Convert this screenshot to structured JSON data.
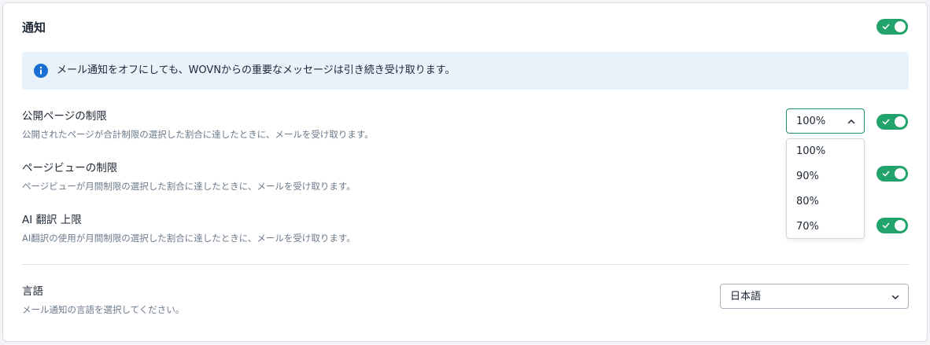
{
  "notifications": {
    "title": "通知",
    "master_toggle_on": true,
    "info_text": "メール通知をオフにしても、WOVNからの重要なメッセージは引き続き受け取ります。",
    "rows": [
      {
        "label": "公開ページの制限",
        "description": "公開されたページが合計制限の選択した割合に達したときに、メールを受け取ります。",
        "toggle_on": true
      },
      {
        "label": "ページビューの制限",
        "description": "ページビューが月間制限の選択した割合に達したときに、メールを受け取ります。",
        "toggle_on": true
      },
      {
        "label": "AI 翻訳 上限",
        "description": "AI翻訳の使用が月間制限の選択した割合に達したときに、メールを受け取ります。",
        "toggle_on": true
      }
    ],
    "threshold_select": {
      "value": "100%",
      "options": [
        "100%",
        "90%",
        "80%",
        "70%"
      ]
    }
  },
  "language": {
    "label": "言語",
    "description": "メール通知の言語を選択してください。",
    "select_value": "日本語"
  },
  "colors": {
    "toggle_on": "#21a36b",
    "info_bg": "#e8f2fb",
    "info_icon": "#1a6fd4"
  },
  "icons": {
    "info": "info-circle-icon",
    "check": "check-icon",
    "chevron_up": "chevron-up-icon",
    "chevron_down": "chevron-down-icon"
  }
}
